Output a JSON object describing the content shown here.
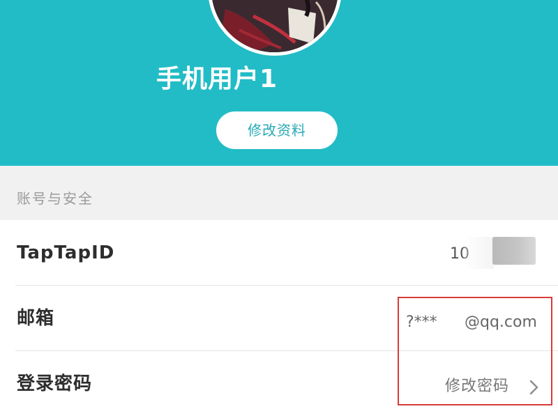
{
  "profile": {
    "username": "手机用户1",
    "edit_profile_label": "修改资料"
  },
  "account_section": {
    "title": "账号与安全",
    "rows": [
      {
        "label": "TapTapID",
        "value": "10"
      },
      {
        "label": "邮箱",
        "value_prefix": "?***",
        "value_suffix": "@qq.com"
      },
      {
        "label": "登录密码",
        "action_label": "修改密码"
      }
    ]
  },
  "colors": {
    "header_bg": "#22bcc6",
    "accent": "#26a8b4",
    "highlight_box": "#d93a3a"
  },
  "icons": {
    "avatar": "avatar-image",
    "row_arrow": "chevron-right-icon"
  }
}
